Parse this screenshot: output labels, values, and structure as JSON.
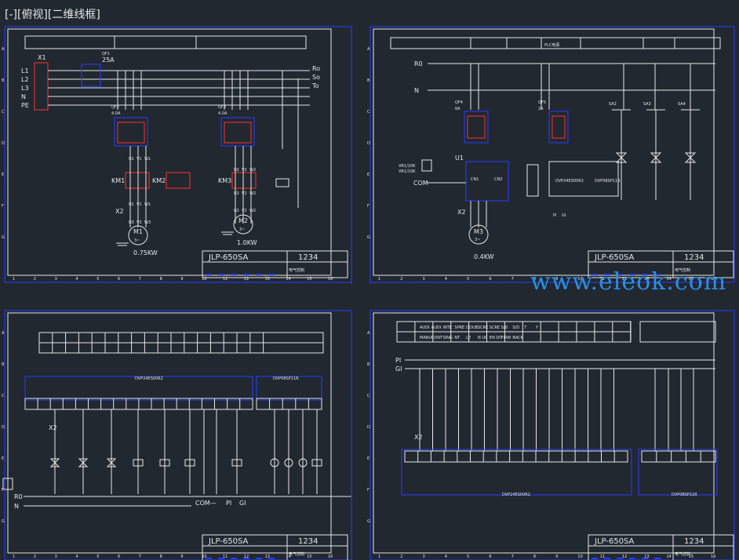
{
  "viewport_label": "[-][俯视][二维线框]",
  "watermark": "www.eleok.com",
  "colors": {
    "background": "#212830",
    "line": "#e8e8e8",
    "frame_blue": "#2a3cff",
    "accent_red": "#ff3030",
    "watermark": "#2e8fe0"
  },
  "sheets": [
    {
      "title_block": {
        "model": "JLP-650SA",
        "code": "1234",
        "desc": "电气控制"
      },
      "top_left": {
        "phases": [
          "L1",
          "L2",
          "L3",
          "N",
          "PE"
        ],
        "terminal": "X1",
        "main_breaker": {
          "name": "QF1",
          "rating": "25A"
        },
        "outputs": [
          "R",
          "S",
          "T"
        ],
        "breakers": [
          {
            "name": "QF2",
            "rating": "4.0A"
          },
          {
            "name": "QF3",
            "rating": "4.0A"
          }
        ],
        "contactors": [
          "KM1",
          "KM2",
          "KM3"
        ],
        "terminal2": "X2",
        "motors": [
          {
            "name": "M1",
            "phase": "3~",
            "power": "0.75KW"
          },
          {
            "name": "M2",
            "phase": "3~",
            "power": "1.0KW"
          }
        ],
        "coil_labels": [
          "U1",
          "V1",
          "W1",
          "U2",
          "V2",
          "W2"
        ],
        "motor_terms1": [
          "U1",
          "V1",
          "W1"
        ],
        "motor_terms2": [
          "U2",
          "V2",
          "W2"
        ],
        "motor_terms3": [
          "U3",
          "V3",
          "W3"
        ],
        "motor_terms4": [
          "U2",
          "V2",
          "W2"
        ]
      }
    },
    {
      "title_block": {
        "model": "JLP-650SA",
        "code": "1234",
        "desc": "电气控制"
      },
      "top_right": {
        "rails": [
          "R0",
          "N"
        ],
        "header": [
          "PLC电源"
        ],
        "breakers": [
          {
            "name": "QF4",
            "rating": "6A"
          },
          {
            "name": "QF5",
            "rating": "2A"
          }
        ],
        "switches": [
          "SA2",
          "SA3",
          "SA4"
        ],
        "inverter": "U1",
        "pot_labels": [
          "VR1/10K",
          "VR1/10K"
        ],
        "com": "COM",
        "cn_labels": [
          "CN1",
          "CN2"
        ],
        "plc_labels": [
          "DVP24ES00R2",
          "DVP08SP11R"
        ],
        "pi_labels": [
          "PI",
          "GI"
        ],
        "terminal2": "X2",
        "motor": {
          "name": "M3",
          "phase": "3~",
          "power": "0.4KW"
        }
      }
    },
    {
      "title_block": {
        "model": "JLP-650SA",
        "code": "1234",
        "desc": "电气控制"
      },
      "bottom_left": {
        "plc_labels": [
          "DVP24ES00R2",
          "DVP08SP11R"
        ],
        "terminal2": "X2",
        "rails": [
          "R0",
          "N"
        ],
        "bus_labels": [
          "COM",
          "PI",
          "GI"
        ]
      }
    },
    {
      "title_block": {
        "model": "JLP-650SA",
        "code": "1234",
        "desc": "电气控制"
      },
      "bottom_right": {
        "header_cells": [
          "AUDI",
          "AUDI",
          "INTE",
          "SPRE",
          "DOUB",
          "SCRE",
          "SCRE",
          "S/D",
          "S/D",
          "T",
          "Y"
        ],
        "header_cells2": [
          "MANU",
          "CONT",
          "SING",
          "NT",
          "LE",
          "N UP",
          "EN DO",
          "FIRW",
          "BACK"
        ],
        "rails": [
          "PI",
          "GI"
        ],
        "terminal2": "X2",
        "plc_labels": [
          "DVP24ES00R2",
          "DVP08SP11R"
        ]
      }
    }
  ]
}
